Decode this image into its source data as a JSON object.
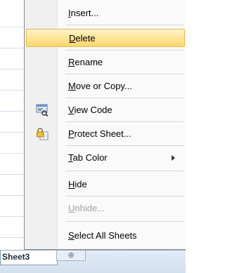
{
  "sheet_tab": {
    "label": "Sheet3",
    "new_tab_glyph": "⊕"
  },
  "menu": {
    "items": [
      {
        "name": "insert",
        "label_acc": "I",
        "label_rest": "nsert...",
        "state": "normal",
        "icon": ""
      },
      {
        "name": "delete",
        "label_acc": "D",
        "label_rest": "elete",
        "state": "hover",
        "icon": ""
      },
      {
        "name": "rename",
        "label_acc": "R",
        "label_rest": "ename",
        "state": "normal",
        "icon": ""
      },
      {
        "name": "move-or-copy",
        "label_acc": "M",
        "label_rest": "ove or Copy...",
        "state": "normal",
        "icon": ""
      },
      {
        "name": "view-code",
        "label_acc": "V",
        "label_rest": "iew Code",
        "state": "normal",
        "icon": "view-code-icon"
      },
      {
        "name": "protect-sheet",
        "label_acc": "P",
        "label_rest": "rotect Sheet...",
        "state": "normal",
        "icon": "protect-sheet-icon"
      },
      {
        "name": "tab-color",
        "label_acc": "T",
        "label_rest": "ab Color",
        "state": "normal",
        "icon": "",
        "submenu": true
      },
      {
        "name": "hide",
        "label_acc": "H",
        "label_rest": "ide",
        "state": "normal",
        "icon": ""
      },
      {
        "name": "unhide",
        "label_acc": "U",
        "label_rest": "nhide...",
        "state": "disabled",
        "icon": ""
      },
      {
        "name": "select-all-sheets",
        "label_acc": "S",
        "label_rest": "elect All Sheets",
        "state": "normal",
        "icon": ""
      }
    ]
  },
  "colors": {
    "hover_top": "#fff3c9",
    "hover_bottom": "#ffd66b",
    "disabled_text": "#a0a0a0"
  }
}
